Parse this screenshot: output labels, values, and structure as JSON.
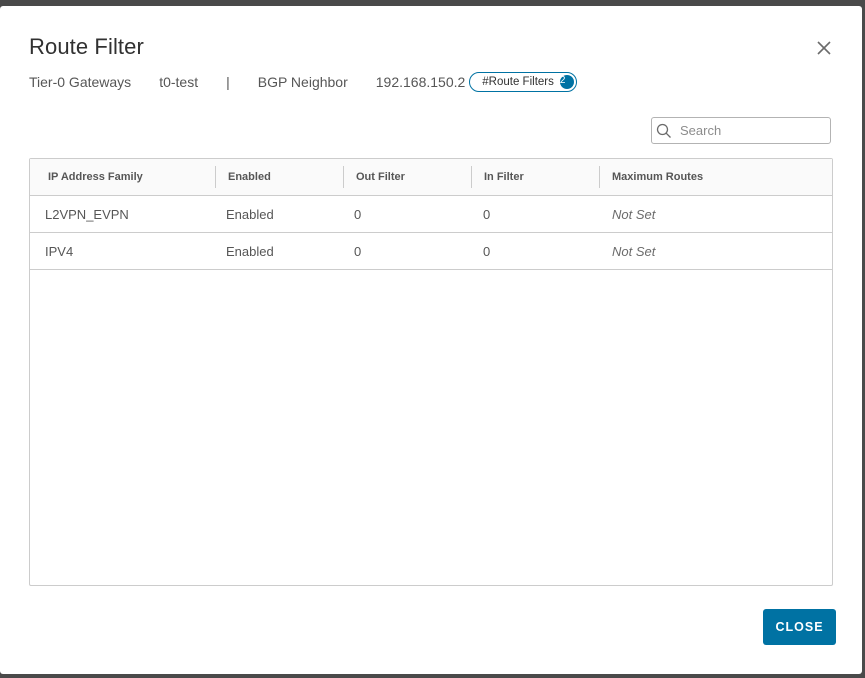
{
  "dialog": {
    "title": "Route Filter",
    "close_icon": "close-icon"
  },
  "breadcrumb": {
    "gateway_type": "Tier-0 Gateways",
    "gateway_name": "t0-test",
    "separator": "|",
    "neighbor_label": "BGP Neighbor",
    "neighbor_ip": "192.168.150.2",
    "route_filters_label": "#Route Filters",
    "route_filters_count": "2"
  },
  "search": {
    "placeholder": "Search",
    "value": "",
    "icon": "search-icon"
  },
  "table": {
    "columns": [
      "IP Address Family",
      "Enabled",
      "Out Filter",
      "In Filter",
      "Maximum Routes"
    ],
    "rows": [
      {
        "family": "L2VPN_EVPN",
        "enabled": "Enabled",
        "out_filter": "0",
        "in_filter": "0",
        "max_routes": "Not Set"
      },
      {
        "family": "IPV4",
        "enabled": "Enabled",
        "out_filter": "0",
        "in_filter": "0",
        "max_routes": "Not Set"
      }
    ]
  },
  "footer": {
    "close_label": "CLOSE"
  },
  "colors": {
    "accent": "#0072a3",
    "text": "#565656",
    "border": "#cccccc"
  }
}
